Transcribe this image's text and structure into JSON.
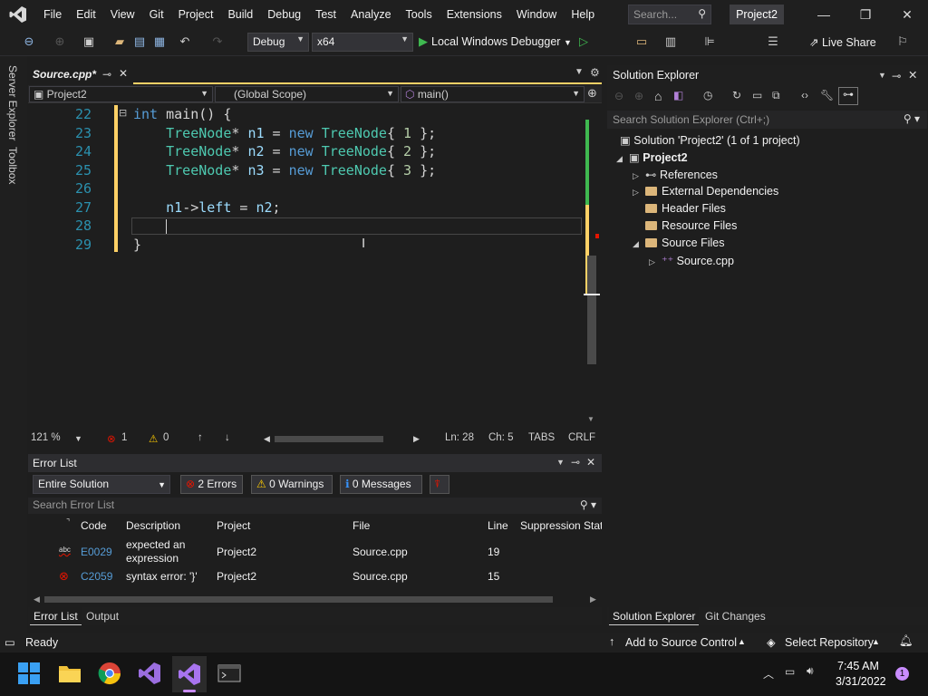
{
  "menu": [
    "File",
    "Edit",
    "View",
    "Git",
    "Project",
    "Build",
    "Debug",
    "Test",
    "Analyze",
    "Tools",
    "Extensions",
    "Window",
    "Help"
  ],
  "search": {
    "placeholder": "Search..."
  },
  "window": {
    "project_chip": "Project2"
  },
  "toolbar": {
    "config": "Debug",
    "platform": "x64",
    "debugger": "Local Windows Debugger",
    "live_share": "Live Share"
  },
  "left_rail": {
    "server_explorer": "Server Explorer",
    "toolbox": "Toolbox"
  },
  "editor": {
    "tab_label": "Source.cpp*",
    "nav_project": "Project2",
    "nav_scope": "(Global Scope)",
    "nav_member": "main()",
    "lines": [
      {
        "n": "22",
        "tokens": [
          {
            "t": "int",
            "c": "kw"
          },
          {
            "t": " main() {",
            "c": "pl"
          }
        ]
      },
      {
        "n": "23",
        "tokens": [
          {
            "t": "    ",
            "c": "pl"
          },
          {
            "t": "TreeNode",
            "c": "ty"
          },
          {
            "t": "* ",
            "c": "pl"
          },
          {
            "t": "n1",
            "c": "vr"
          },
          {
            "t": " = ",
            "c": "pl"
          },
          {
            "t": "new",
            "c": "kw"
          },
          {
            "t": " ",
            "c": "pl"
          },
          {
            "t": "TreeNode",
            "c": "ty"
          },
          {
            "t": "{ ",
            "c": "pl"
          },
          {
            "t": "1",
            "c": "nm"
          },
          {
            "t": " };",
            "c": "pl"
          }
        ]
      },
      {
        "n": "24",
        "tokens": [
          {
            "t": "    ",
            "c": "pl"
          },
          {
            "t": "TreeNode",
            "c": "ty"
          },
          {
            "t": "* ",
            "c": "pl"
          },
          {
            "t": "n2",
            "c": "vr"
          },
          {
            "t": " = ",
            "c": "pl"
          },
          {
            "t": "new",
            "c": "kw"
          },
          {
            "t": " ",
            "c": "pl"
          },
          {
            "t": "TreeNode",
            "c": "ty"
          },
          {
            "t": "{ ",
            "c": "pl"
          },
          {
            "t": "2",
            "c": "nm"
          },
          {
            "t": " };",
            "c": "pl"
          }
        ]
      },
      {
        "n": "25",
        "tokens": [
          {
            "t": "    ",
            "c": "pl"
          },
          {
            "t": "TreeNode",
            "c": "ty"
          },
          {
            "t": "* ",
            "c": "pl"
          },
          {
            "t": "n3",
            "c": "vr"
          },
          {
            "t": " = ",
            "c": "pl"
          },
          {
            "t": "new",
            "c": "kw"
          },
          {
            "t": " ",
            "c": "pl"
          },
          {
            "t": "TreeNode",
            "c": "ty"
          },
          {
            "t": "{ ",
            "c": "pl"
          },
          {
            "t": "3",
            "c": "nm"
          },
          {
            "t": " };",
            "c": "pl"
          }
        ]
      },
      {
        "n": "26",
        "tokens": []
      },
      {
        "n": "27",
        "tokens": [
          {
            "t": "    ",
            "c": "pl"
          },
          {
            "t": "n1",
            "c": "vr"
          },
          {
            "t": "->",
            "c": "pl"
          },
          {
            "t": "left",
            "c": "vr"
          },
          {
            "t": " = ",
            "c": "pl"
          },
          {
            "t": "n2",
            "c": "vr"
          },
          {
            "t": ";",
            "c": "pl"
          }
        ]
      },
      {
        "n": "28",
        "tokens": []
      },
      {
        "n": "29",
        "tokens": [
          {
            "t": "}",
            "c": "pl"
          }
        ]
      }
    ]
  },
  "editor_status": {
    "zoom": "121 %",
    "errors": "1",
    "warnings": "0",
    "ln": "Ln: 28",
    "ch": "Ch: 5",
    "tabs": "TABS",
    "eol": "CRLF"
  },
  "error_list": {
    "title": "Error List",
    "scope": "Entire Solution",
    "errors_btn": "2 Errors",
    "warnings_btn": "0 Warnings",
    "messages_btn": "0 Messages",
    "search_placeholder": "Search Error List",
    "columns": {
      "code": "Code",
      "description": "Description",
      "project": "Project",
      "file": "File",
      "line": "Line",
      "suppression": "Suppression State"
    },
    "rows": [
      {
        "code": "E0029",
        "description_1": "expected an",
        "description_2": "expression",
        "project": "Project2",
        "file": "Source.cpp",
        "line": "19"
      },
      {
        "code": "C2059",
        "description_1": "syntax error: '}'",
        "description_2": "",
        "project": "Project2",
        "file": "Source.cpp",
        "line": "15"
      }
    ],
    "tab_errors": "Error List",
    "tab_output": "Output"
  },
  "solution_explorer": {
    "title": "Solution Explorer",
    "search_placeholder": "Search Solution Explorer (Ctrl+;)",
    "solution": "Solution 'Project2' (1 of 1 project)",
    "project": "Project2",
    "references": "References",
    "external": "External Dependencies",
    "headers": "Header Files",
    "resources": "Resource Files",
    "sources": "Source Files",
    "source_cpp": "Source.cpp",
    "tab_se": "Solution Explorer",
    "tab_git": "Git Changes"
  },
  "statusbar": {
    "ready": "Ready",
    "add_source": "Add to Source Control",
    "select_repo": "Select Repository"
  },
  "taskbar": {
    "time": "7:45 AM",
    "date": "3/31/2022",
    "notif": "1"
  },
  "colors": {
    "accent": "#ffd166",
    "error": "#e51400",
    "link": "#569cd6",
    "type": "#4ec9b0",
    "keyword": "#569cd6"
  }
}
